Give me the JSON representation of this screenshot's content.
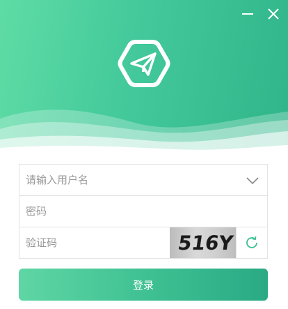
{
  "window": {
    "controls": {
      "minimize_icon": "minimize-icon",
      "close_icon": "close-icon"
    }
  },
  "header": {
    "logo_icon": "paper-plane-hexagon-icon",
    "colors": {
      "gradient_start": "#5fdca5",
      "gradient_end": "#2fb589"
    }
  },
  "form": {
    "username": {
      "placeholder": "请输入用户名",
      "value": "",
      "dropdown_icon": "chevron-down-icon"
    },
    "password": {
      "placeholder": "密码",
      "value": ""
    },
    "captcha": {
      "placeholder": "验证码",
      "value": "",
      "image_text": "516Y",
      "refresh_icon": "refresh-icon"
    }
  },
  "login_button": {
    "label": "登录",
    "color": "#3dbf92"
  }
}
